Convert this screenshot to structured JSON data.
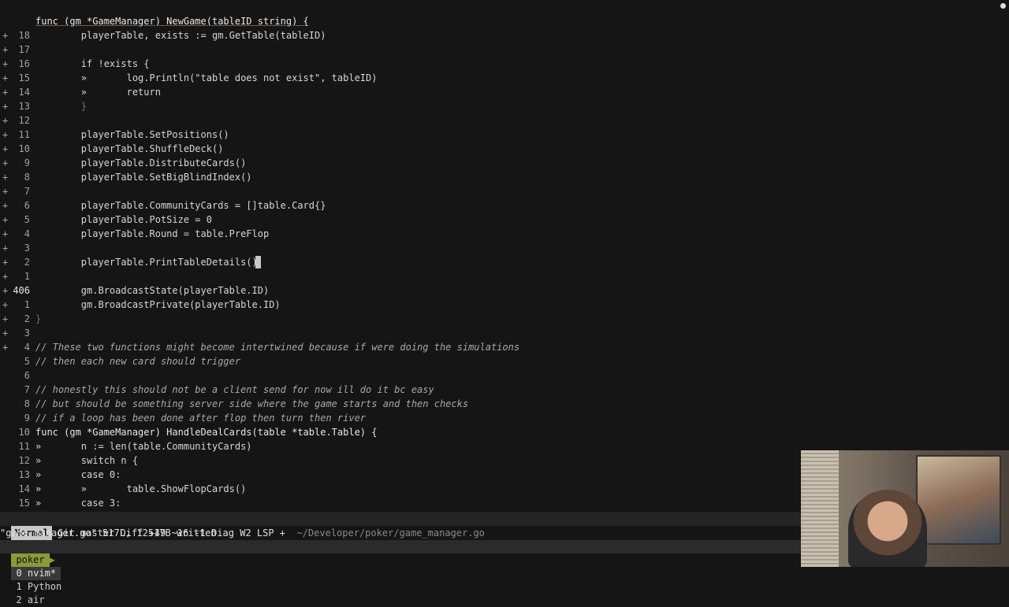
{
  "editor": {
    "lines": [
      {
        "sign": "",
        "num": "18",
        "code": ""
      },
      {
        "sign": "+",
        "num": "17",
        "code": "func (gm *GameManager) NewGame(tableID string) {"
      },
      {
        "sign": "+",
        "num": "16",
        "code": "        playerTable, exists := gm.GetTable(tableID)"
      },
      {
        "sign": "+",
        "num": "15",
        "code": ""
      },
      {
        "sign": "+",
        "num": "14",
        "code": "        if !exists {"
      },
      {
        "sign": "+",
        "num": "13",
        "code": "        »       log.Println(\"table does not exist\", tableID)"
      },
      {
        "sign": "+",
        "num": "12",
        "code": "        »       return"
      },
      {
        "sign": "+",
        "num": "11",
        "code": "        }"
      },
      {
        "sign": "+",
        "num": "10",
        "code": ""
      },
      {
        "sign": "+",
        "num": "9",
        "code": "        playerTable.SetPositions()"
      },
      {
        "sign": "+",
        "num": "8",
        "code": "        playerTable.ShuffleDeck()"
      },
      {
        "sign": "+",
        "num": "7",
        "code": "        playerTable.DistributeCards()"
      },
      {
        "sign": "+",
        "num": "6",
        "code": "        playerTable.SetBigBlindIndex()"
      },
      {
        "sign": "+",
        "num": "5",
        "code": ""
      },
      {
        "sign": "+",
        "num": "4",
        "code": "        playerTable.CommunityCards = []table.Card{}"
      },
      {
        "sign": "+",
        "num": "3",
        "code": "        playerTable.PotSize = 0"
      },
      {
        "sign": "+",
        "num": "2",
        "code": "        playerTable.Round = table.PreFlop"
      },
      {
        "sign": "+",
        "num": "1",
        "code": ""
      },
      {
        "sign": "+",
        "num": "406",
        "code": "        playerTable.PrintTableDetails()"
      },
      {
        "sign": "+",
        "num": "1",
        "code": ""
      },
      {
        "sign": "+",
        "num": "2",
        "code": "        gm.BroadcastState(playerTable.ID)"
      },
      {
        "sign": "+",
        "num": "3",
        "code": "        gm.BroadcastPrivate(playerTable.ID)"
      },
      {
        "sign": "+",
        "num": "4",
        "code": "}"
      },
      {
        "sign": "+",
        "num": "5",
        "code": ""
      },
      {
        "sign": "",
        "num": "6",
        "code": "// These two functions might become intertwined because if were doing the simulations"
      },
      {
        "sign": "",
        "num": "7",
        "code": "// then each new card should trigger"
      },
      {
        "sign": "",
        "num": "8",
        "code": ""
      },
      {
        "sign": "",
        "num": "9",
        "code": "// honestly this should not be a client send for now ill do it bc easy"
      },
      {
        "sign": "",
        "num": "10",
        "code": "// but should be something server side where the game starts and then checks"
      },
      {
        "sign": "",
        "num": "11",
        "code": "// if a loop has been done after flop then turn then river"
      },
      {
        "sign": "",
        "num": "12",
        "code": "func (gm *GameManager) HandleDealCards(table *table.Table) {"
      },
      {
        "sign": "",
        "num": "13",
        "code": "»       n := len(table.CommunityCards)"
      },
      {
        "sign": "",
        "num": "14",
        "code": "»       switch n {"
      },
      {
        "sign": "",
        "num": "15",
        "code": "»       case 0:"
      },
      {
        "sign": "",
        "num": "16",
        "code": "»       »       table.ShowFlopCards()"
      },
      {
        "sign": "",
        "num": "17",
        "code": "»       case 3:"
      }
    ]
  },
  "statusline": {
    "mode": "Normal",
    "info": " Git master Diff +49 ~16 -1 Diag W2 LSP + ",
    "path": " ~/Developer/poker/game_manager.go"
  },
  "cmdline": "\"game_manager.go\" 517L, 12517B written",
  "tmux": {
    "session": "poker",
    "windows": [
      "0 nvim*",
      "1 Python",
      "2 air"
    ]
  },
  "colors": {
    "background": "#151515",
    "mode_bg": "#c9c9c9",
    "tmux_session_bg": "#8a9a3a"
  }
}
